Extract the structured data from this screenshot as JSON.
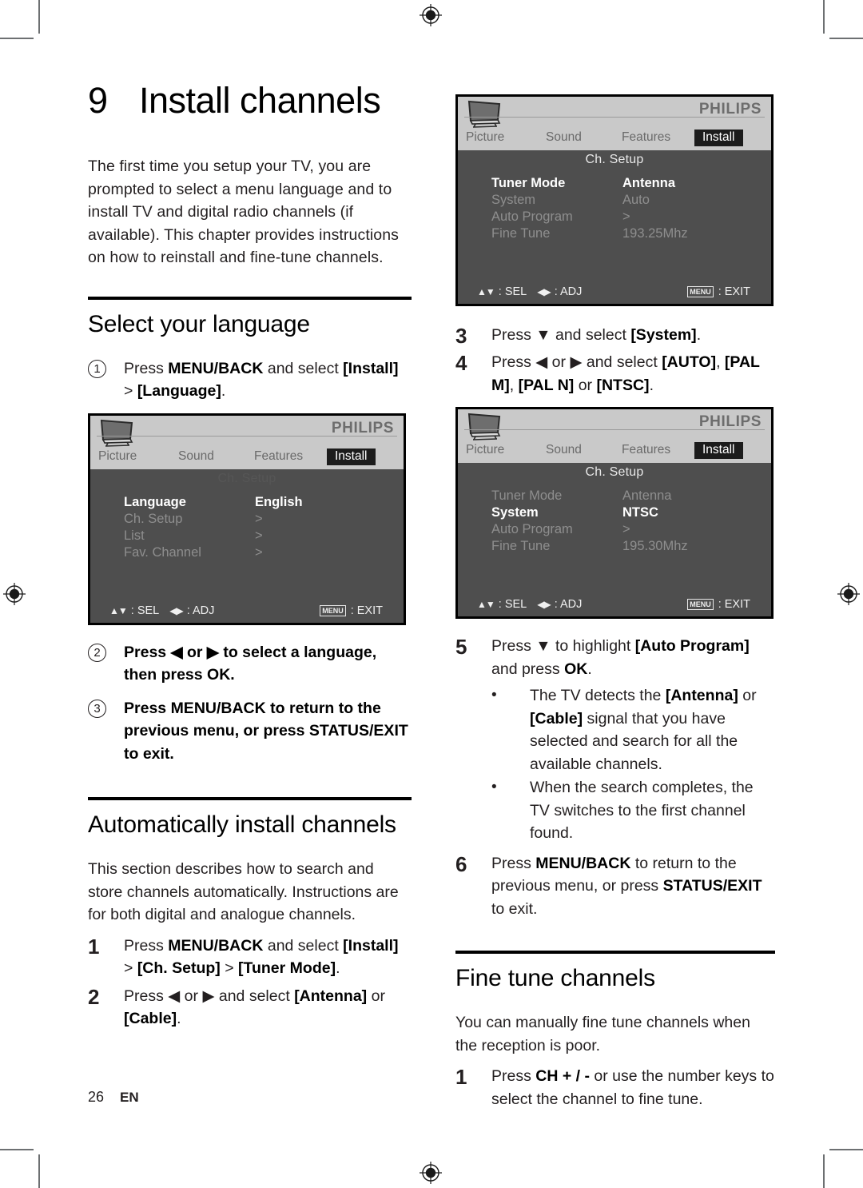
{
  "document": {
    "chapter_number": "9",
    "chapter_title": "Install channels",
    "intro": "The first time you setup your TV, you are prompted to select a menu language and to install TV and digital radio channels (if available). This chapter provides instructions on how to reinstall and fine-tune channels.",
    "footer_page": "26",
    "footer_lang": "EN"
  },
  "sections": {
    "select_language": {
      "heading": "Select your language",
      "step1_marker": "1",
      "step1_text_a": "Press ",
      "step1_bold_a": "MENU/BACK",
      "step1_text_b": " and select ",
      "step1_bold_b": "[Install]",
      "step1_text_c": " > ",
      "step1_bold_c": "[Language]",
      "step1_text_d": ".",
      "step2_marker": "2",
      "step2_text_a": "Press ",
      "step2_arrow_left": "◀",
      "step2_text_b": " or ",
      "step2_arrow_right": "▶",
      "step2_text_c": " to select a language, then press ",
      "step2_bold_ok": "OK",
      "step2_text_d": ".",
      "step3_marker": "3",
      "step3_text_a": "Press ",
      "step3_bold_a": "MENU/BACK",
      "step3_text_b": " to return to the previous menu, or press ",
      "step3_bold_b": "STATUS/EXIT",
      "step3_text_c": " to exit."
    },
    "auto_install": {
      "heading": "Automatically install channels",
      "intro": "This section describes how to search and store channels automatically. Instructions are for both digital and analogue channels.",
      "step1_marker": "1",
      "step1_text_a": "Press ",
      "step1_bold_a": "MENU/BACK",
      "step1_text_b": " and select ",
      "step1_bold_b": "[Install]",
      "step1_text_c": " > ",
      "step1_bold_c": "[Ch. Setup]",
      "step1_text_d": " > ",
      "step1_bold_d": "[Tuner Mode]",
      "step1_text_e": ".",
      "step2_marker": "2",
      "step2_text_a": "Press ",
      "step2_arrow_left": "◀",
      "step2_text_b": " or ",
      "step2_arrow_right": "▶",
      "step2_text_c": " and select ",
      "step2_bold_a": "[Antenna]",
      "step2_text_d": " or ",
      "step2_bold_b": "[Cable]",
      "step2_text_e": ".",
      "step3_marker": "3",
      "step3_text_a": "Press ",
      "step3_arrow_down": "▼",
      "step3_text_b": " and select ",
      "step3_bold_a": "[System]",
      "step3_text_c": ".",
      "step4_marker": "4",
      "step4_text_a": "Press ",
      "step4_arrow_left": "◀",
      "step4_text_b": " or ",
      "step4_arrow_right": "▶",
      "step4_text_c": " and select ",
      "step4_bold_a": "[AUTO]",
      "step4_text_d": ", ",
      "step4_bold_b": "[PAL M]",
      "step4_text_e": ", ",
      "step4_bold_c": "[PAL N]",
      "step4_text_f": " or ",
      "step4_bold_d": "[NTSC]",
      "step4_text_g": ".",
      "step5_marker": "5",
      "step5_text_a": "Press ",
      "step5_arrow_down": "▼",
      "step5_text_b": " to highlight ",
      "step5_bold_a": "[Auto Program]",
      "step5_text_c": " and press ",
      "step5_bold_ok": "OK",
      "step5_text_d": ".",
      "step5_bullet1_bullet": "•",
      "step5_bullet1_a": "The TV detects the ",
      "step5_bullet1_bold_a": "[Antenna]",
      "step5_bullet1_b": " or ",
      "step5_bullet1_bold_b": "[Cable]",
      "step5_bullet1_c": " signal that you have selected and search for all the available channels.",
      "step5_bullet2_bullet": "•",
      "step5_bullet2_a": "When the search completes, the TV switches to the first channel found.",
      "step6_marker": "6",
      "step6_text_a": "Press ",
      "step6_bold_a": "MENU/BACK",
      "step6_text_b": " to return to the previous menu, or press ",
      "step6_bold_b": "STATUS/EXIT",
      "step6_text_c": " to exit."
    },
    "fine_tune": {
      "heading": "Fine tune channels",
      "intro": "You can manually fine tune channels when the reception is poor.",
      "step1_marker": "1",
      "step1_text_a": "Press ",
      "step1_bold_a": "CH + / -",
      "step1_text_b": " or use the number keys to select the channel to fine tune."
    }
  },
  "osd_screens": [
    {
      "id": "ch-setup-antenna",
      "brand": "PHILIPS",
      "tabs": [
        "Picture",
        "Sound",
        "Features",
        "Install"
      ],
      "selected_tab": "Install",
      "subtitle": "Ch. Setup",
      "subtitle_ghost": false,
      "rows": [
        {
          "label": "Tuner Mode",
          "value": "Antenna",
          "highlight": "label"
        },
        {
          "label": "System",
          "value": "Auto",
          "highlight": "none"
        },
        {
          "label": "Auto Program",
          "value": ">",
          "highlight": "none"
        },
        {
          "label": "Fine Tune",
          "value": "193.25Mhz",
          "highlight": "none"
        }
      ],
      "hint_sel_icon": "▲▼",
      "hint_sel": ": SEL",
      "hint_adj_icon": "◀▶",
      "hint_adj": ": ADJ",
      "hint_menu_key": "MENU",
      "hint_exit": ": EXIT"
    },
    {
      "id": "install-language",
      "brand": "PHILIPS",
      "tabs": [
        "Picture",
        "Sound",
        "Features",
        "Install"
      ],
      "selected_tab": "Install",
      "subtitle": "Ch. Setup",
      "subtitle_ghost": true,
      "rows": [
        {
          "label": "Language",
          "value": "English",
          "highlight": "label"
        },
        {
          "label": "Ch. Setup",
          "value": ">",
          "highlight": "none"
        },
        {
          "label": "List",
          "value": ">",
          "highlight": "none"
        },
        {
          "label": "Fav. Channel",
          "value": ">",
          "highlight": "none"
        }
      ],
      "hint_sel_icon": "▲▼",
      "hint_sel": ": SEL",
      "hint_adj_icon": "◀▶",
      "hint_adj": ": ADJ",
      "hint_menu_key": "MENU",
      "hint_exit": ": EXIT"
    },
    {
      "id": "ch-setup-ntsc",
      "brand": "PHILIPS",
      "tabs": [
        "Picture",
        "Sound",
        "Features",
        "Install"
      ],
      "selected_tab": "Install",
      "subtitle": "Ch. Setup",
      "subtitle_ghost": false,
      "rows": [
        {
          "label": "Tuner Mode",
          "value": "Antenna",
          "highlight": "none"
        },
        {
          "label": "System",
          "value": "NTSC",
          "highlight": "both"
        },
        {
          "label": "Auto Program",
          "value": ">",
          "highlight": "none"
        },
        {
          "label": "Fine Tune",
          "value": "195.30Mhz",
          "highlight": "none"
        }
      ],
      "hint_sel_icon": "▲▼",
      "hint_sel": ": SEL",
      "hint_adj_icon": "◀▶",
      "hint_adj": ": ADJ",
      "hint_menu_key": "MENU",
      "hint_exit": ": EXIT"
    }
  ],
  "colors": {
    "osd_background": "#4e4e4e",
    "osd_header": "#c9c9c9",
    "osd_selected_tab": "#1c1c1c",
    "text": "#231f20",
    "crop_mark": "#6d7072"
  }
}
